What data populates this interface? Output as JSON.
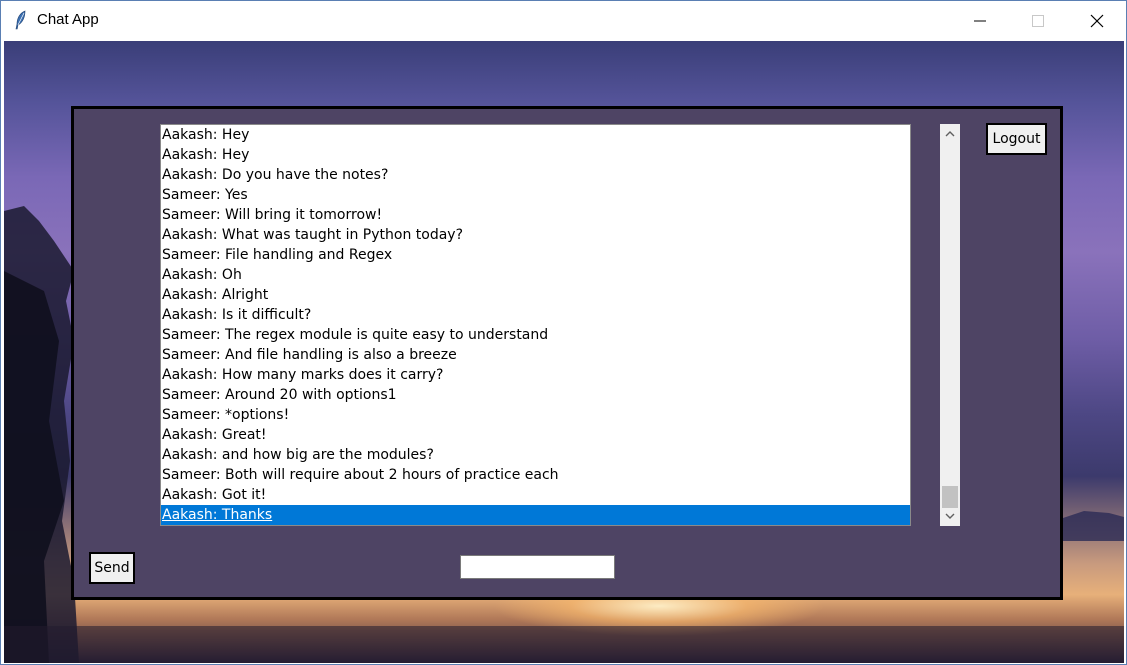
{
  "window": {
    "title": "Chat App",
    "icon": "feather-icon"
  },
  "colors": {
    "panel_bg": "#4e4464",
    "selection": "#0078d7",
    "button_bg": "#f0f0f0"
  },
  "chat": {
    "messages": [
      "Aakash: Hey",
      "Aakash: Hey",
      "Aakash: Do you have the notes?",
      "Sameer: Yes",
      "Sameer: Will bring it tomorrow!",
      "Aakash: What was taught in Python today?",
      "Sameer: File handling and Regex",
      "Aakash: Oh",
      "Aakash: Alright",
      "Aakash: Is it difficult?",
      "Sameer: The regex module is quite easy to understand",
      "Sameer: And file handling is also a breeze",
      "Aakash: How many marks does it carry?",
      "Sameer: Around 20 with options1",
      "Sameer: *options!",
      "Aakash: Great!",
      "Aakash: and how big are the modules?",
      "Sameer: Both will require about 2 hours of practice each",
      "Aakash: Got it!",
      "Aakash: Thanks"
    ],
    "selected_index": 19
  },
  "controls": {
    "logout_label": "Logout",
    "send_label": "Send",
    "message_value": ""
  }
}
